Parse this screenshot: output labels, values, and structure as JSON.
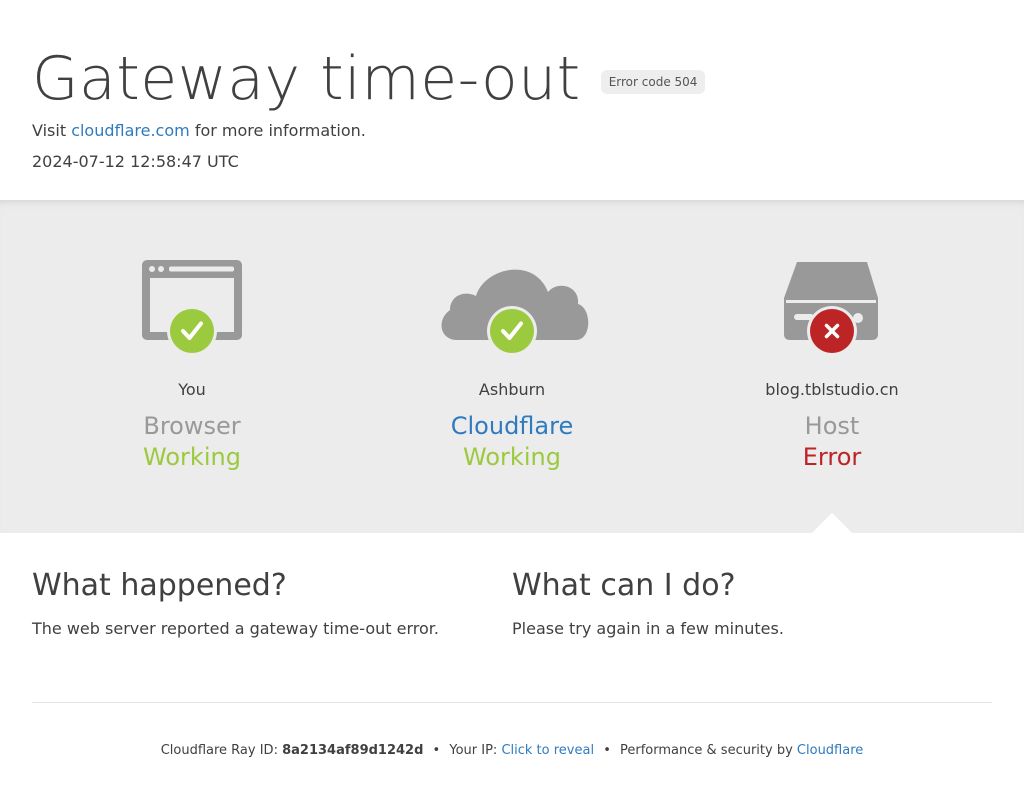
{
  "header": {
    "title": "Gateway time-out",
    "error_badge": "Error code 504",
    "visit_prefix": "Visit",
    "visit_link": "cloudflare.com",
    "visit_suffix": "for more information.",
    "timestamp": "2024-07-12 12:58:47 UTC"
  },
  "status": {
    "browser": {
      "location": "You",
      "kind": "Browser",
      "state": "Working",
      "icon": "browser-icon",
      "badge_icon": "check-icon"
    },
    "cloudflare": {
      "location": "Ashburn",
      "kind": "Cloudflare",
      "state": "Working",
      "icon": "cloud-icon",
      "badge_icon": "check-icon"
    },
    "host": {
      "location": "blog.tblstudio.cn",
      "kind": "Host",
      "state": "Error",
      "icon": "server-icon",
      "badge_icon": "x-icon"
    }
  },
  "info": {
    "happened_title": "What happened?",
    "happened_text": "The web server reported a gateway time-out error.",
    "cando_title": "What can I do?",
    "cando_text": "Please try again in a few minutes."
  },
  "footer": {
    "ray_label": "Cloudflare Ray ID:",
    "ray_id": "8a2134af89d1242d",
    "bullet": "•",
    "ip_label": "Your IP:",
    "ip_link": "Click to reveal",
    "perf_label": "Performance & security by",
    "perf_link": "Cloudflare"
  },
  "colors": {
    "ok": "#9bca3e",
    "error": "#bd2426",
    "link": "#2f7bbf",
    "icon_gray": "#999999"
  }
}
